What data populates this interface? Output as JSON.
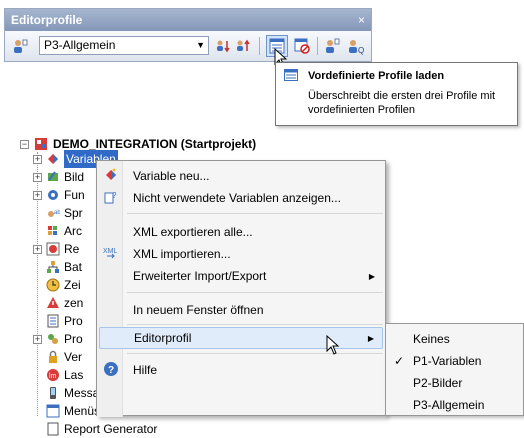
{
  "toolbar_window": {
    "title": "Editorprofile",
    "close_glyph": "×",
    "profile_combo_value": "P3-Allgemein"
  },
  "tooltip": {
    "title": "Vordefinierte Profile laden",
    "body": "Überschreibt die ersten drei Profile mit vordefinierten Profilen"
  },
  "tree": {
    "root_label": "DEMO_INTEGRATION (Startprojekt)",
    "items": [
      "Variablen",
      "Bild",
      "Fun",
      "Spr",
      "Arc",
      "Re",
      "Bat",
      "Zei",
      "zen",
      "Pro",
      "Pro",
      "Ver",
      "Las",
      "Message Control",
      "Menüs",
      "Report Generator"
    ]
  },
  "context_menu": {
    "items": [
      "Variable neu...",
      "Nicht verwendete Variablen anzeigen...",
      "XML exportieren alle...",
      "XML importieren...",
      "Erweiterter Import/Export",
      "In neuem Fenster öffnen",
      "Editorprofil",
      "Hilfe"
    ]
  },
  "submenu": {
    "items": [
      "Keines",
      "P1-Variablen",
      "P2-Bilder",
      "P3-Allgemein"
    ],
    "checked_index": 1,
    "check_glyph": "✓"
  },
  "colors": {
    "title_bar": "#8e9fbd",
    "highlight": "#e1ecfa",
    "highlight_border": "#a7c4ea",
    "tree_selection": "#3169c6"
  }
}
